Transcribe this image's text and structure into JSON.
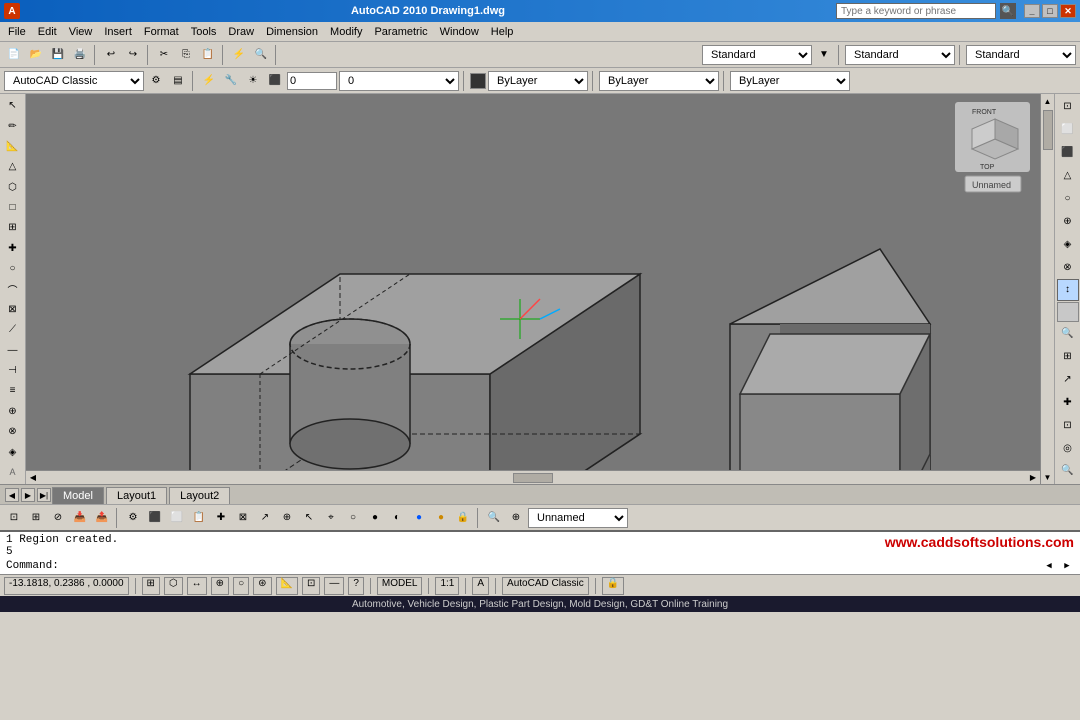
{
  "titlebar": {
    "search_placeholder": "Type a keyword or phrase",
    "title": "AutoCAD 2010  Drawing1.dwg",
    "win_controls": [
      "_",
      "□",
      "✕"
    ]
  },
  "menubar": {
    "items": [
      "File",
      "Edit",
      "View",
      "Insert",
      "Format",
      "Tools",
      "Draw",
      "Dimension",
      "Modify",
      "Parametric",
      "Window",
      "Help"
    ]
  },
  "toolbar1": {
    "dropdowns": [
      "Standard",
      "Standard",
      "Standard"
    ]
  },
  "toolbar2": {
    "workspace_dropdown": "AutoCAD Classic",
    "layer_input": "0",
    "color_dropdown": "ByLayer",
    "linetype_dropdown": "ByLayer",
    "lineweight_dropdown": "ByLayer"
  },
  "tabs": {
    "items": [
      "Model",
      "Layout1",
      "Layout2"
    ]
  },
  "command_area": {
    "output_line1": "1 Region created.",
    "output_line2": "5",
    "promo": "www.caddsoftsolutions.com",
    "prompt": "Command:"
  },
  "status_bar": {
    "coordinates": "-13.1818, 0.2386 , 0.0000",
    "model_button": "MODEL",
    "ratio": "1:1",
    "workspace": "AutoCAD Classic"
  },
  "ad_bar": {
    "text": "Automotive, Vehicle Design, Plastic Part Design, Mold Design, GD&T Online Training"
  },
  "viewport": {
    "unnamed_label": "Unnamed"
  },
  "icons": {
    "arrow": "▶",
    "back": "◀",
    "up": "▲",
    "down": "▼",
    "close": "✕",
    "minimize": "_",
    "maximize": "□"
  }
}
